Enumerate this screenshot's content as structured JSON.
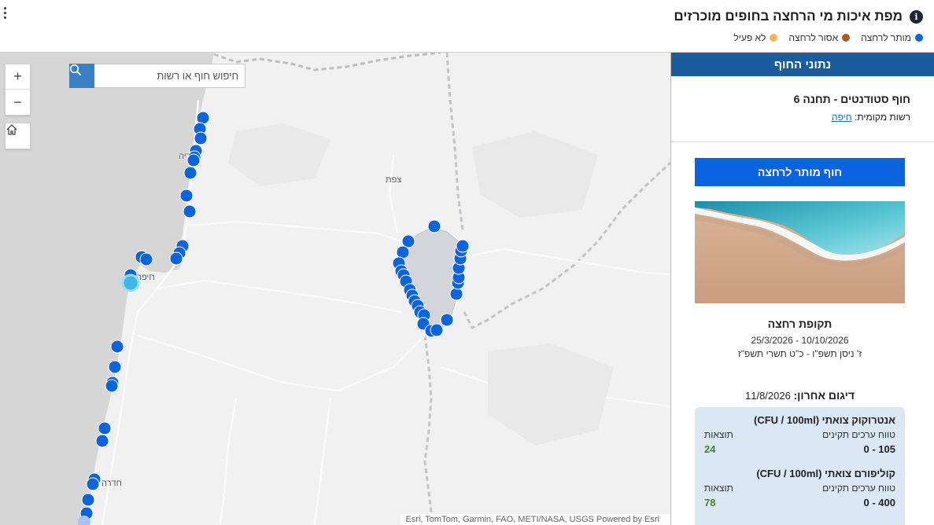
{
  "header": {
    "title": "מפת איכות מי הרחצה בחופים מוכרזים",
    "info_icon": "i",
    "legend": [
      {
        "label": "מותר לרחצה",
        "color": "#0a64e0"
      },
      {
        "label": "אסור לרחצה",
        "color": "#b5561f"
      },
      {
        "label": "לא פעיל",
        "color": "#f4b55a"
      }
    ]
  },
  "map": {
    "search_placeholder": "חיפוש חוף או רשות",
    "zoom_in": "+",
    "zoom_out": "−",
    "labels": {
      "nahariya": "נהריה",
      "haifa": "חיפה",
      "safed": "צפת",
      "hadera": "חדרה"
    },
    "attribution": "Esri, TomTom, Garmin, FAO, METI/NASA, USGS   Powered by Esri",
    "marker_colors": {
      "allowed": "#0a64e0",
      "selected": "#3fb6e8"
    }
  },
  "panel": {
    "header": "נתוני החוף",
    "beach_name": "חוף סטודנטים - תחנה 6",
    "authority_label": "רשות מקומית:",
    "authority_value": "חיפה",
    "status": "חוף מותר לרחצה",
    "season_title": "תקופת רחצה",
    "season_dates": "25/3/2026 - 10/10/2026",
    "season_hebrew": "ז' ניסן תשפ\"ו - כ\"ט תשרי תשפ\"ז",
    "sample_label": "דיגום אחרון:",
    "sample_date": "11/8/2026",
    "results": [
      {
        "title": "אנטרוקוק צואתי (CFU / 100ml)",
        "range_label": "טווח ערכים תקינים",
        "result_label": "תוצאות",
        "range": "0 - 105",
        "value": "24"
      },
      {
        "title": "קוליפורם צואתי (CFU / 100ml)",
        "range_label": "טווח ערכים תקינים",
        "result_label": "תוצאות",
        "range": "0 - 400",
        "value": "78"
      }
    ]
  }
}
